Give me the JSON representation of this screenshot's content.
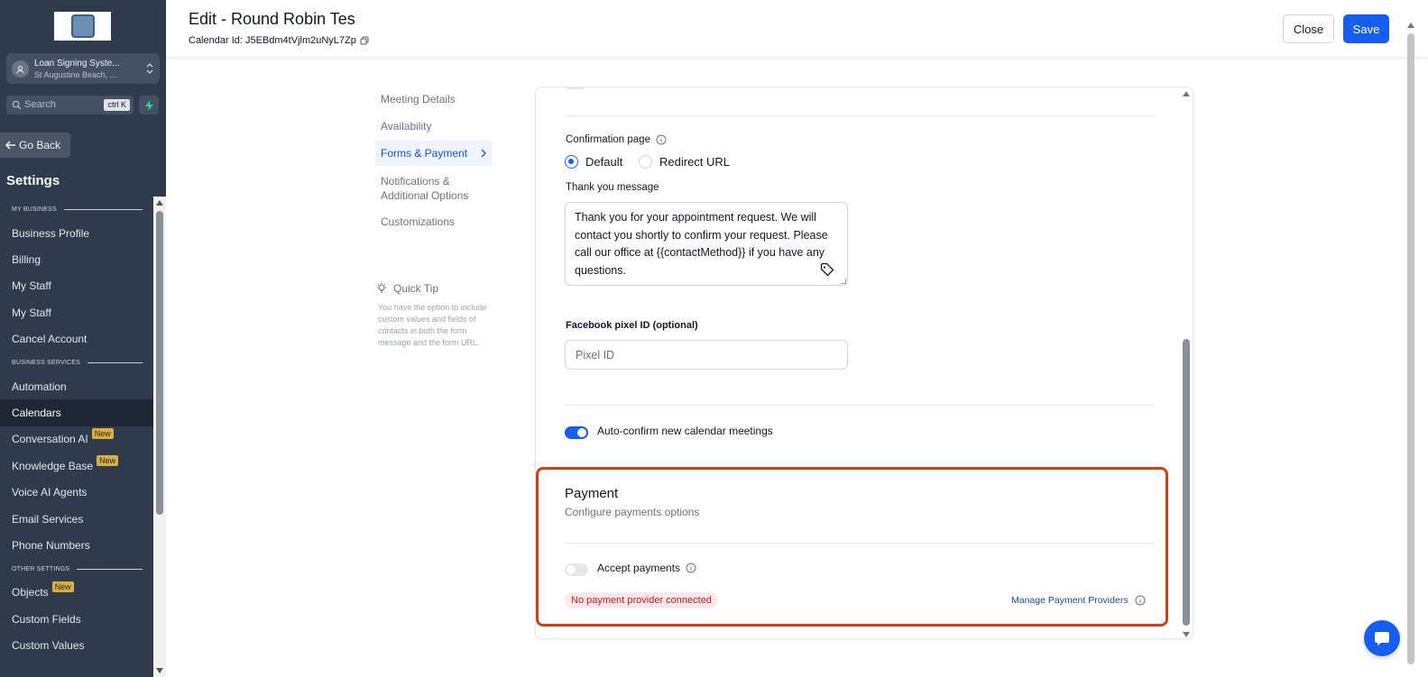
{
  "sidebar": {
    "account_name": "Loan Signing Syste...",
    "account_location": "St Augustine Beach, ...",
    "search_placeholder": "Search",
    "search_shortcut": "ctrl K",
    "go_back": "Go Back",
    "settings_title": "Settings",
    "sections": [
      {
        "label": "MY BUSINESS"
      },
      {
        "label": "BUSINESS SERVICES"
      },
      {
        "label": "OTHER SETTINGS"
      }
    ],
    "items": [
      {
        "label": "Business Profile"
      },
      {
        "label": "Billing"
      },
      {
        "label": "My Staff"
      },
      {
        "label": "My Staff"
      },
      {
        "label": "Cancel Account"
      },
      {
        "label": "Automation"
      },
      {
        "label": "Calendars"
      },
      {
        "label": "Conversation AI",
        "badge": "New"
      },
      {
        "label": "Knowledge Base",
        "badge": "New"
      },
      {
        "label": "Voice AI Agents"
      },
      {
        "label": "Email Services"
      },
      {
        "label": "Phone Numbers"
      },
      {
        "label": "Objects",
        "badge": "New"
      },
      {
        "label": "Custom Fields"
      },
      {
        "label": "Custom Values"
      }
    ],
    "active_item": "Calendars"
  },
  "header": {
    "title": "Edit - Round Robin Tes",
    "calendar_id": "Calendar Id: J5EBdm4tVjlm2uNyL7Zp",
    "close_label": "Close",
    "save_label": "Save"
  },
  "submenu": {
    "items": [
      {
        "label": "Meeting Details"
      },
      {
        "label": "Availability"
      },
      {
        "label": "Forms & Payment"
      },
      {
        "label": "Notifications & Additional Options"
      },
      {
        "label": "Customizations"
      }
    ],
    "active": "Forms & Payment"
  },
  "quick_tip": {
    "title": "Quick Tip",
    "text": "You have the option to include custom values and fields of contacts in both the form message and the form URL."
  },
  "form": {
    "confirmation_page_label": "Confirmation page",
    "radio_default": "Default",
    "radio_redirect": "Redirect URL",
    "selected_option": "Default",
    "thank_you_label": "Thank you message",
    "thank_you_message": "Thank you for your appointment request. We will contact you shortly to confirm your request. Please call our office at {{contactMethod}} if you have any questions.",
    "pixel_label": "Facebook pixel ID (optional)",
    "pixel_placeholder": "Pixel ID",
    "auto_confirm_label": "Auto-confirm new calendar meetings",
    "auto_confirm_on": true
  },
  "payment": {
    "title": "Payment",
    "subtitle": "Configure payments options",
    "accept_label": "Accept payments",
    "accept_on": false,
    "status_badge": "No payment provider connected",
    "manage_link": "Manage Payment Providers"
  },
  "colors": {
    "sidebar_bg": "#2f3a4c",
    "primary": "#155eef",
    "highlight": "#d23f12",
    "badge": "#d9b13b"
  }
}
